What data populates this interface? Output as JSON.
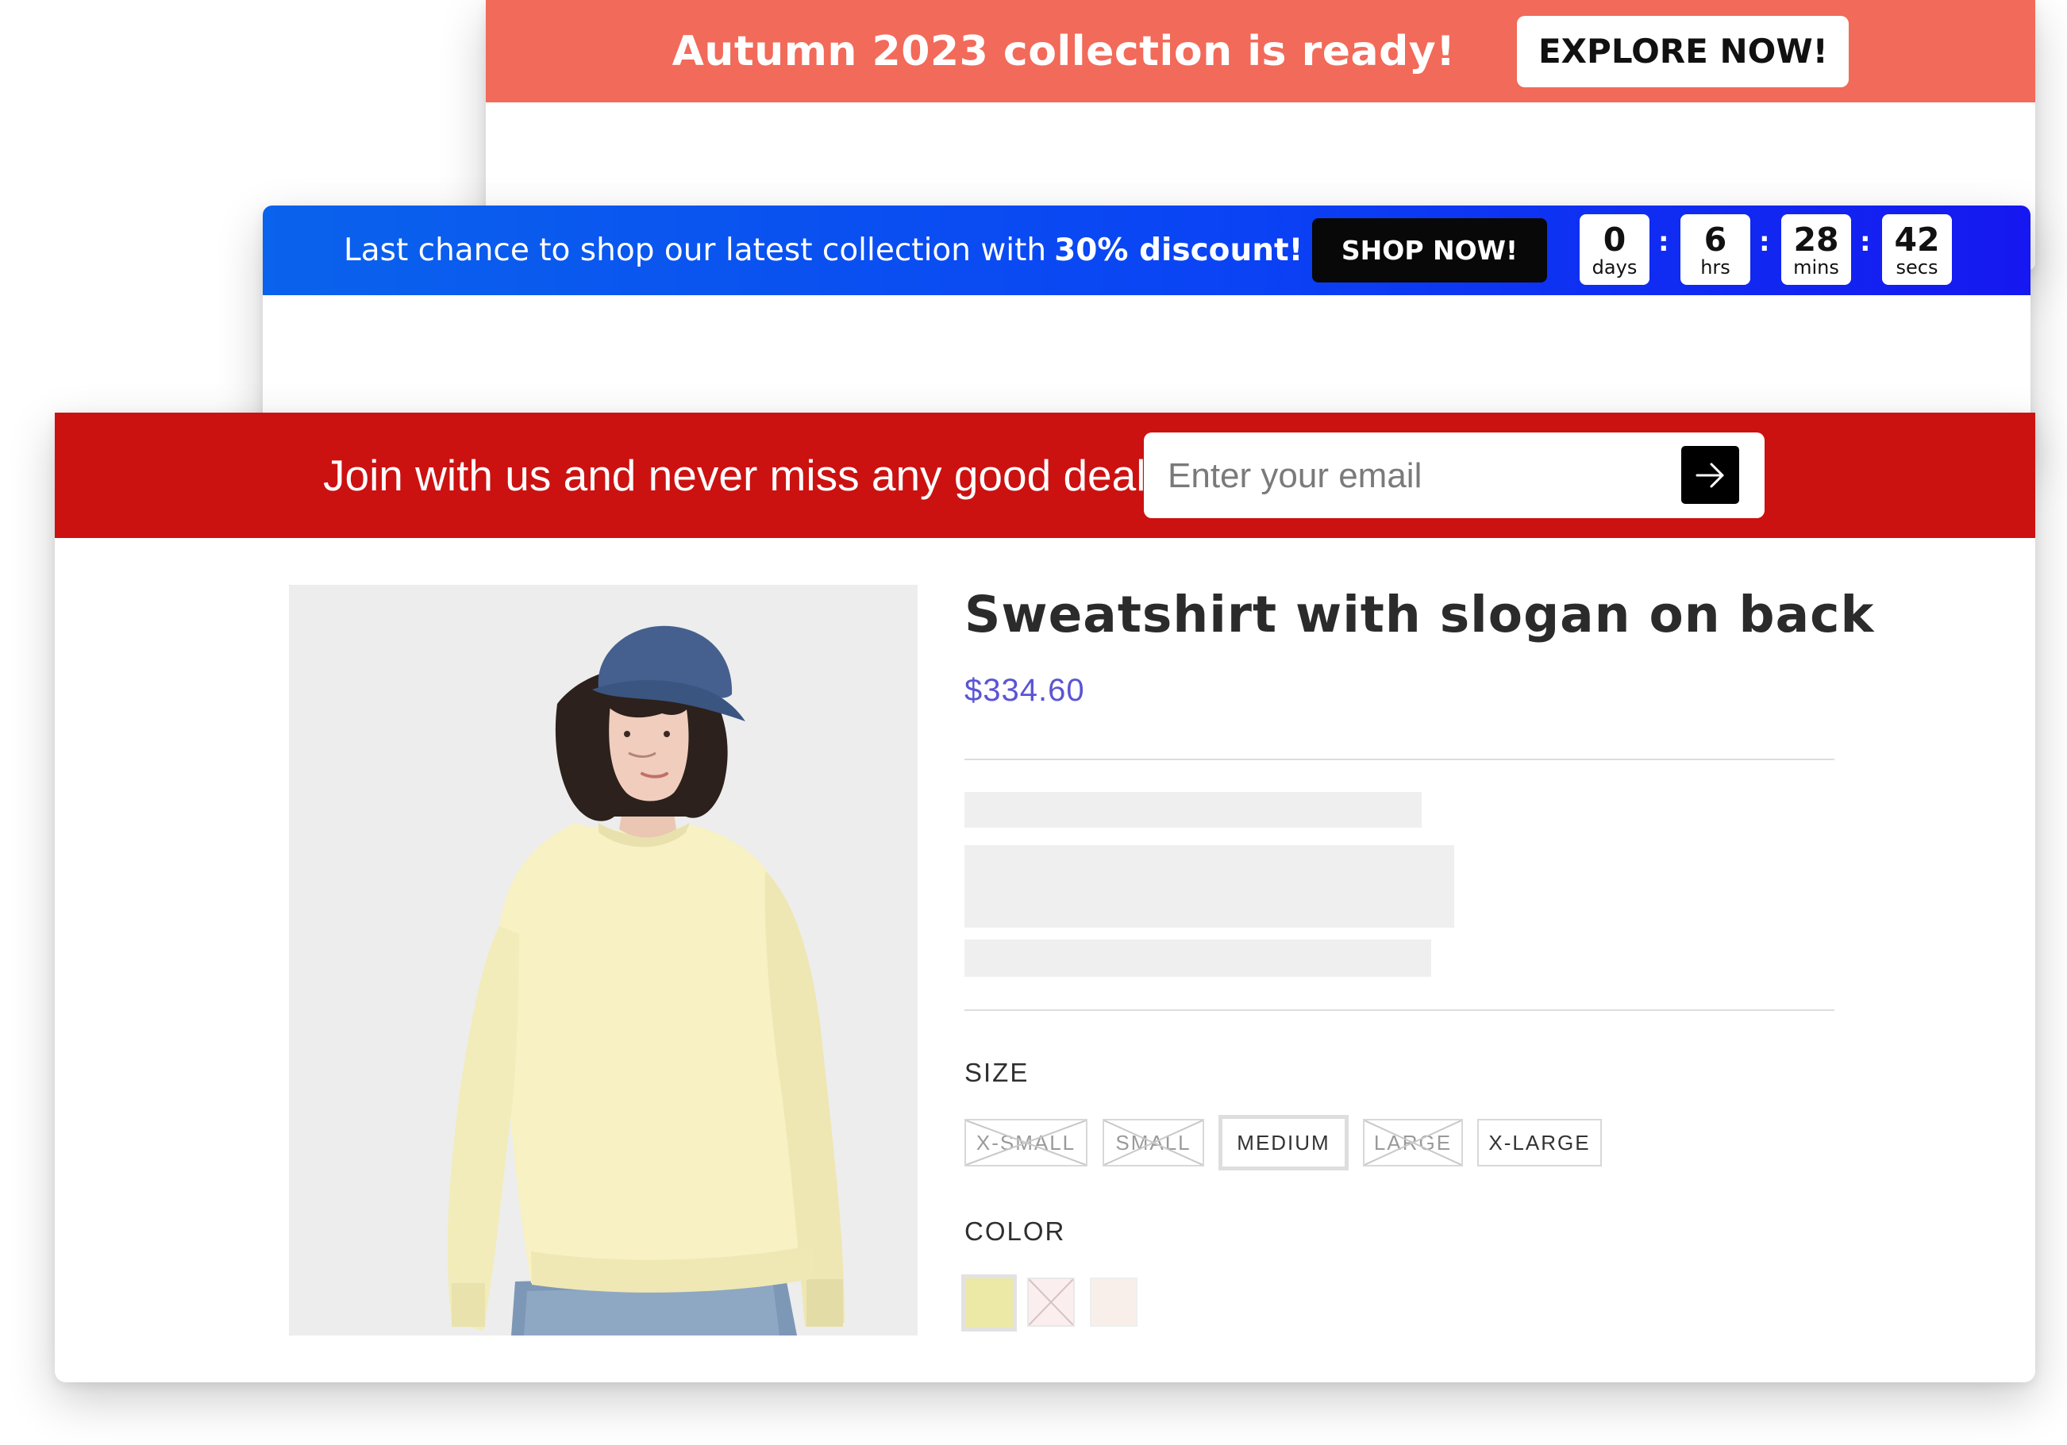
{
  "banner_autumn": {
    "text": "Autumn 2023 collection is ready!",
    "button": "EXPLORE NOW!",
    "bg_color": "#f26a59"
  },
  "banner_sale": {
    "text": "Last chance to shop our latest collection with",
    "highlight": "30% discount!",
    "button": "SHOP NOW!",
    "countdown": [
      {
        "value": "0",
        "unit": "days"
      },
      {
        "value": "6",
        "unit": "hrs"
      },
      {
        "value": "28",
        "unit": "mins"
      },
      {
        "value": "42",
        "unit": "secs"
      }
    ],
    "separator": ":"
  },
  "banner_newsletter": {
    "text": "Join with us and never miss any good deal!",
    "email_placeholder": "Enter your email",
    "submit_icon": "arrow-right-icon",
    "bg_color": "#cc1111"
  },
  "product": {
    "title": "Sweatshirt with slogan on back",
    "price": "$334.60",
    "price_color": "#5b55d4",
    "size_label": "SIZE",
    "sizes": [
      {
        "label": "X-SMALL",
        "available": false,
        "selected": false
      },
      {
        "label": "SMALL",
        "available": false,
        "selected": false
      },
      {
        "label": "MEDIUM",
        "available": true,
        "selected": true
      },
      {
        "label": "LARGE",
        "available": false,
        "selected": false
      },
      {
        "label": "X-LARGE",
        "available": true,
        "selected": false
      }
    ],
    "color_label": "COLOR",
    "colors": [
      {
        "hex": "#ece8a6",
        "available": true,
        "selected": true
      },
      {
        "hex": "#fbeeee",
        "available": false,
        "selected": false
      },
      {
        "hex": "#f8efea",
        "available": true,
        "selected": false
      }
    ]
  }
}
